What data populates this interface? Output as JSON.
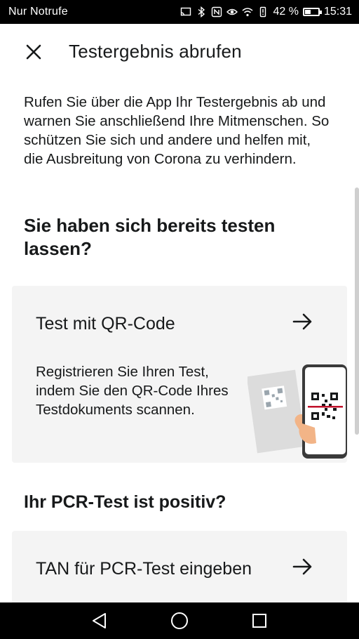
{
  "status_bar": {
    "carrier": "Nur Notrufe",
    "battery": "42 %",
    "battery_level": 0.42,
    "time": "15:31",
    "icons": [
      "cast-icon",
      "bluetooth-icon",
      "nfc-icon",
      "eye-icon",
      "wifi-icon",
      "vibrate-icon",
      "battery-icon"
    ]
  },
  "header": {
    "title": "Testergebnis abrufen",
    "close_icon": "close-icon"
  },
  "intro": "Rufen Sie über die App Ihr Testergebnis ab und warnen Sie anschließend Ihre Mitmenschen. So schützen Sie sich und andere und helfen mit, die Ausbreitung von Corona zu verhindern.",
  "sections": [
    {
      "heading": "Sie haben sich bereits testen lassen?",
      "card": {
        "title": "Test mit QR-Code",
        "text": "Registrieren Sie Ihren Test, indem Sie den QR-Code Ihres Testdokuments scannen.",
        "icon": "arrow-right-icon",
        "illustration": "qr-scan-illustration"
      }
    },
    {
      "heading": "Ihr PCR-Test ist positiv?",
      "card": {
        "title": "TAN für PCR-Test eingeben",
        "icon": "arrow-right-icon"
      }
    }
  ],
  "nav_bar": {
    "icons": [
      "back-icon",
      "home-icon",
      "recents-icon"
    ]
  },
  "colors": {
    "card_background": "#f4f4f4",
    "text": "#17191a",
    "accent_red": "#c0102a"
  }
}
